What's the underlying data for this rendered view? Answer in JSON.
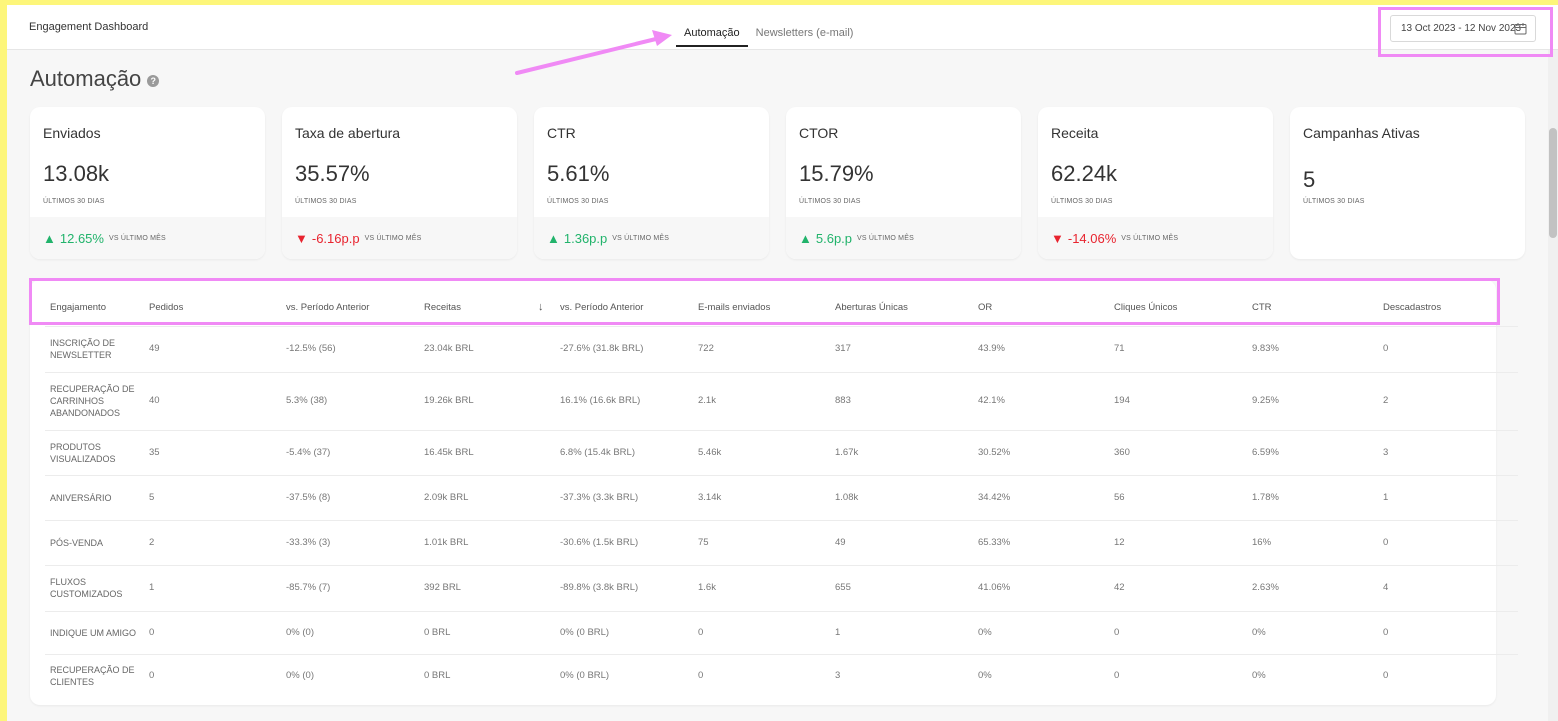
{
  "colors": {
    "accent_highlight": "#f08af5",
    "up": "#21b36b",
    "down": "#e8242f",
    "frame": "#fdf67a"
  },
  "header": {
    "title": "Engagement Dashboard",
    "tabs": [
      {
        "label": "Automação",
        "active": true
      },
      {
        "label": "Newsletters (e-mail)",
        "active": false
      }
    ],
    "date_range": "13 Oct 2023 - 12 Nov 2023",
    "date_icon": "calendar-icon"
  },
  "section": {
    "title": "Automação",
    "help_icon": "help-icon",
    "help_glyph": "?"
  },
  "kpis": [
    {
      "label": "Enviados",
      "value": "13.08k",
      "period": "ÚLTIMOS 30 DIAS",
      "trend": "up",
      "arrow": "▲",
      "change": "12.65%",
      "vs": "VS ÚLTIMO MÊS"
    },
    {
      "label": "Taxa de abertura",
      "value": "35.57%",
      "period": "ÚLTIMOS 30 DIAS",
      "trend": "down",
      "arrow": "▼",
      "change": "-6.16p.p",
      "vs": "VS ÚLTIMO MÊS"
    },
    {
      "label": "CTR",
      "value": "5.61%",
      "period": "ÚLTIMOS 30 DIAS",
      "trend": "up",
      "arrow": "▲",
      "change": "1.36p.p",
      "vs": "VS ÚLTIMO MÊS"
    },
    {
      "label": "CTOR",
      "value": "15.79%",
      "period": "ÚLTIMOS 30 DIAS",
      "trend": "up",
      "arrow": "▲",
      "change": "5.6p.p",
      "vs": "VS ÚLTIMO MÊS"
    },
    {
      "label": "Receita",
      "value": "62.24k",
      "period": "ÚLTIMOS 30 DIAS",
      "trend": "down",
      "arrow": "▼",
      "change": "-14.06%",
      "vs": "VS ÚLTIMO MÊS"
    },
    {
      "label": "Campanhas Ativas",
      "value": "5",
      "period": "ÚLTIMOS 30 DIAS"
    }
  ],
  "table": {
    "sort_icon": "sort-down-icon",
    "sort_glyph": "↓",
    "columns": [
      "Engajamento",
      "Pedidos",
      "vs. Período Anterior",
      "Receitas",
      "vs. Período Anterior",
      "E-mails enviados",
      "Aberturas Únicas",
      "OR",
      "Cliques Únicos",
      "CTR",
      "Descadastros"
    ],
    "rows": [
      [
        "Inscrição de Newsletter",
        "49",
        "-12.5% (56)",
        "23.04k BRL",
        "-27.6% (31.8k BRL)",
        "722",
        "317",
        "43.9%",
        "71",
        "9.83%",
        "0"
      ],
      [
        "Recuperação de Carrinhos Abandonados",
        "40",
        "5.3% (38)",
        "19.26k BRL",
        "16.1% (16.6k BRL)",
        "2.1k",
        "883",
        "42.1%",
        "194",
        "9.25%",
        "2"
      ],
      [
        "Produtos Visualizados",
        "35",
        "-5.4% (37)",
        "16.45k BRL",
        "6.8% (15.4k BRL)",
        "5.46k",
        "1.67k",
        "30.52%",
        "360",
        "6.59%",
        "3"
      ],
      [
        "Aniversário",
        "5",
        "-37.5% (8)",
        "2.09k BRL",
        "-37.3% (3.3k BRL)",
        "3.14k",
        "1.08k",
        "34.42%",
        "56",
        "1.78%",
        "1"
      ],
      [
        "Pós-venda",
        "2",
        "-33.3% (3)",
        "1.01k BRL",
        "-30.6% (1.5k BRL)",
        "75",
        "49",
        "65.33%",
        "12",
        "16%",
        "0"
      ],
      [
        "Fluxos Customizados",
        "1",
        "-85.7% (7)",
        "392 BRL",
        "-89.8% (3.8k BRL)",
        "1.6k",
        "655",
        "41.06%",
        "42",
        "2.63%",
        "4"
      ],
      [
        "Indique um Amigo",
        "0",
        "0% (0)",
        "0 BRL",
        "0% (0 BRL)",
        "0",
        "1",
        "0%",
        "0",
        "0%",
        "0"
      ],
      [
        "Recuperação de Clientes",
        "0",
        "0% (0)",
        "0 BRL",
        "0% (0 BRL)",
        "0",
        "3",
        "0%",
        "0",
        "0%",
        "0"
      ]
    ]
  }
}
